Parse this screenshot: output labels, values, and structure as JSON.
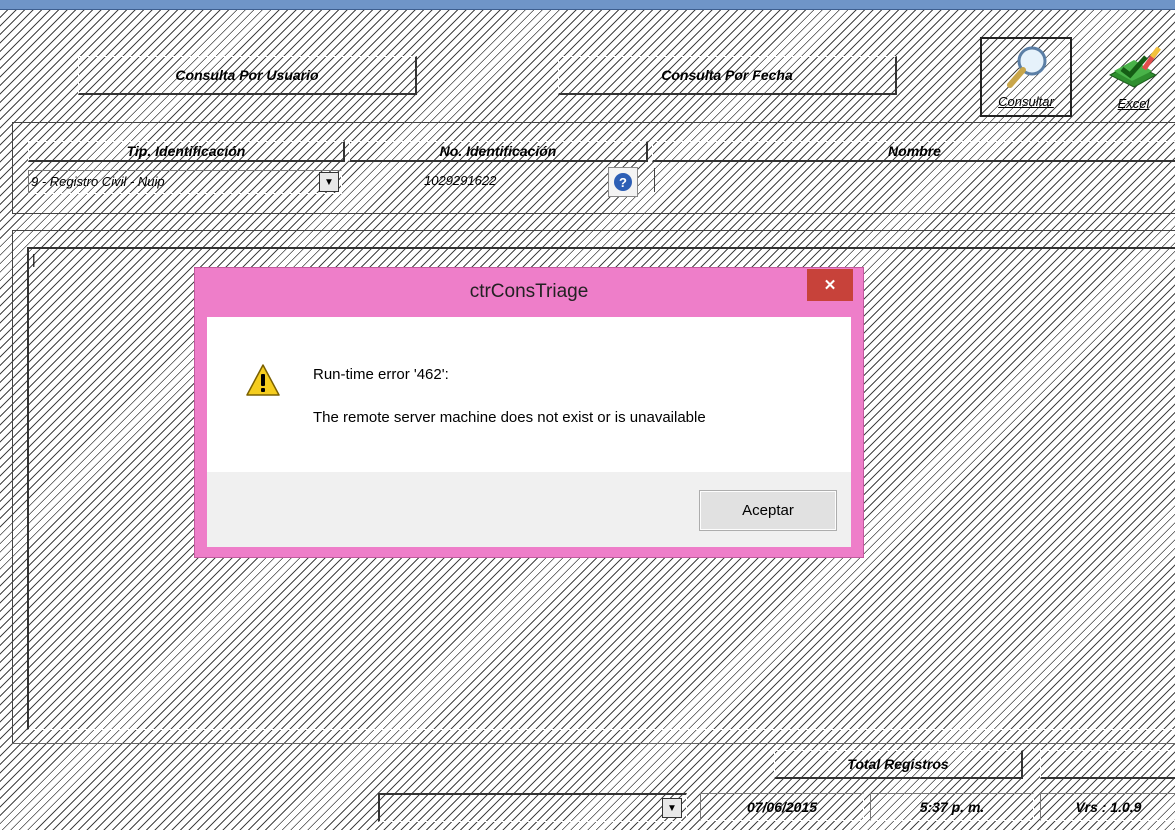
{
  "header": {
    "tab_user": "Consulta Por Usuario",
    "tab_date": "Consulta Por Fecha",
    "btn_consultar": "Consultar",
    "btn_excel": "Excel"
  },
  "form": {
    "col_tipo": "Tip. Identificación",
    "col_numero": "No. Identificación",
    "col_nombre": "Nombre",
    "tipo_value": "9 - Registro Civil - Nuip",
    "numero_value": "1029291622",
    "nombre_value": ""
  },
  "results": {
    "cursor": "|"
  },
  "footer": {
    "total_label": "Total Registros",
    "total_value": "",
    "combo_value": "",
    "date": "07/06/2015",
    "time": "5:37 p. m.",
    "version": "Vrs : 1.0.9"
  },
  "dialog": {
    "title": "ctrConsTriage",
    "line1": "Run-time error '462':",
    "line2": "The remote server machine does not exist or is unavailable",
    "ok": "Aceptar",
    "close_glyph": "✕"
  },
  "icons": {
    "warning": "warning-icon",
    "magnifier": "magnifier-icon",
    "excel": "excel-icon",
    "help": "help-icon",
    "dropdown": "chevron-down-icon"
  },
  "colors": {
    "dialog_frame": "#ee7ec9",
    "close_button": "#c7423a",
    "title_bar": "#6f95c8"
  }
}
